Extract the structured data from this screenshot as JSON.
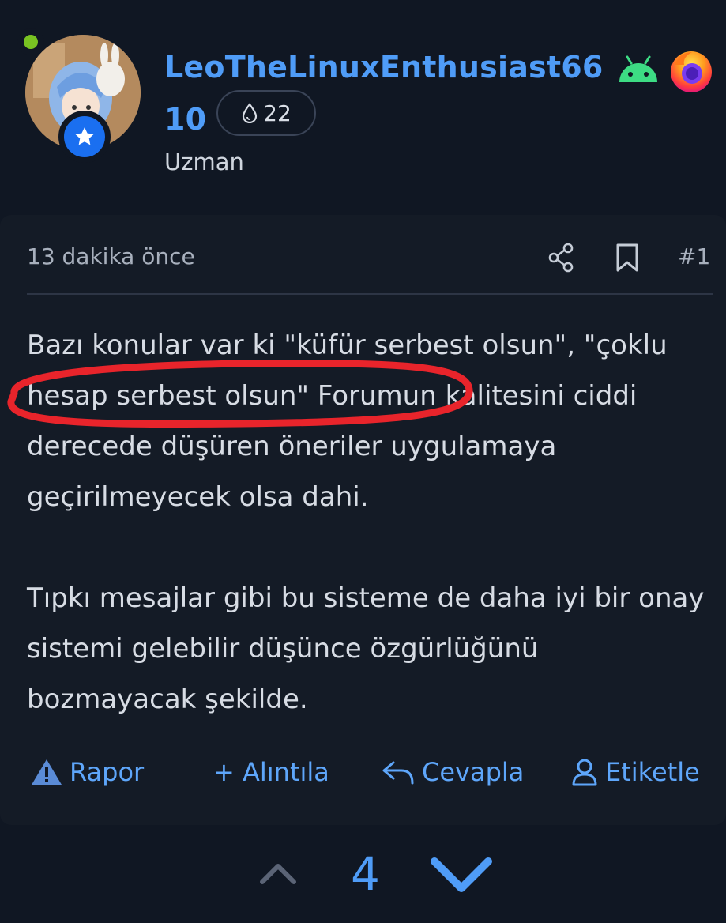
{
  "author": {
    "name": "LeoTheLinuxEnthusiast66",
    "name_line2": "10",
    "title": "Uzman",
    "reaction_count": "22",
    "icons": {
      "online": "online-dot",
      "rank": "star-badge-icon",
      "reaction": "drop-icon",
      "os": "android-icon",
      "browser": "firefox-icon"
    }
  },
  "post": {
    "timestamp": "13 dakika önce",
    "number": "#1",
    "paragraph1": "Bazı konular var ki \"küfür serbest olsun\", \"çoklu hesap serbest olsun\" Forumun kalitesini ciddi derecede düşüren öneriler uygulamaya geçirilmeyecek olsa dahi.",
    "paragraph2": "Tıpkı mesajlar gibi bu sisteme de daha iyi bir onay sistemi gelebilir düşünce özgürlüğünü bozmayacak şekilde.",
    "highlight_color": "#e8242b"
  },
  "actions": {
    "report": "Rapor",
    "quote": "+ Alıntıla",
    "reply": "Cevapla",
    "tag": "Etiketle"
  },
  "vote": {
    "count": "4"
  },
  "colors": {
    "background": "#101723",
    "accent": "#4f9cf7",
    "online": "#79c322"
  }
}
